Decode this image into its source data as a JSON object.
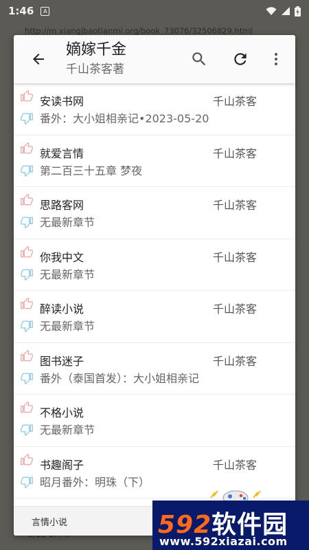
{
  "status_bar": {
    "time": "1:46",
    "app_badge": "A"
  },
  "background": {
    "url": "http://m.xiangjbaotianmi.org/book_73076/32506829.html",
    "progress": "1/12 0.4%"
  },
  "toolbar": {
    "title": "嫡嫁千金",
    "subtitle": "千山茶客著"
  },
  "sources": [
    {
      "name": "安读书网",
      "author": "千山茶客",
      "chapter": "番外：大小姐相亲记•2023-05-20"
    },
    {
      "name": "就爱言情",
      "author": "千山茶客",
      "chapter": "第二百三十五章 梦夜"
    },
    {
      "name": "思路客网",
      "author": "千山茶客",
      "chapter": "无最新章节"
    },
    {
      "name": "你我中文",
      "author": "千山茶客",
      "chapter": "无最新章节"
    },
    {
      "name": "醉读小说",
      "author": "千山茶客",
      "chapter": "无最新章节"
    },
    {
      "name": "图书迷子",
      "author": "千山茶客",
      "chapter": "番外（泰国首发）：大小姐相亲记"
    },
    {
      "name": "不格小说",
      "author": "",
      "chapter": "无最新章节"
    },
    {
      "name": "书趣阁子",
      "author": "千山茶客",
      "chapter": "昭月番外：明珠（下）"
    }
  ],
  "footer": {
    "label": "言情小说"
  },
  "watermark": {
    "brand": "592软件园",
    "brand_num": "592",
    "brand_cn": "软件园",
    "url": "www.592xiazai.com"
  },
  "colors": {
    "thumb_up": "#f2a0a0",
    "thumb_down": "#86c6e6",
    "watermark_bg": "#0a1a6b",
    "watermark_accent": "#ff6a1a"
  },
  "icons": {
    "back": "arrow-back-icon",
    "search": "search-icon",
    "refresh": "refresh-icon",
    "more": "more-vert-icon",
    "thumb_up": "thumb-up-icon",
    "thumb_down": "thumb-down-icon"
  }
}
